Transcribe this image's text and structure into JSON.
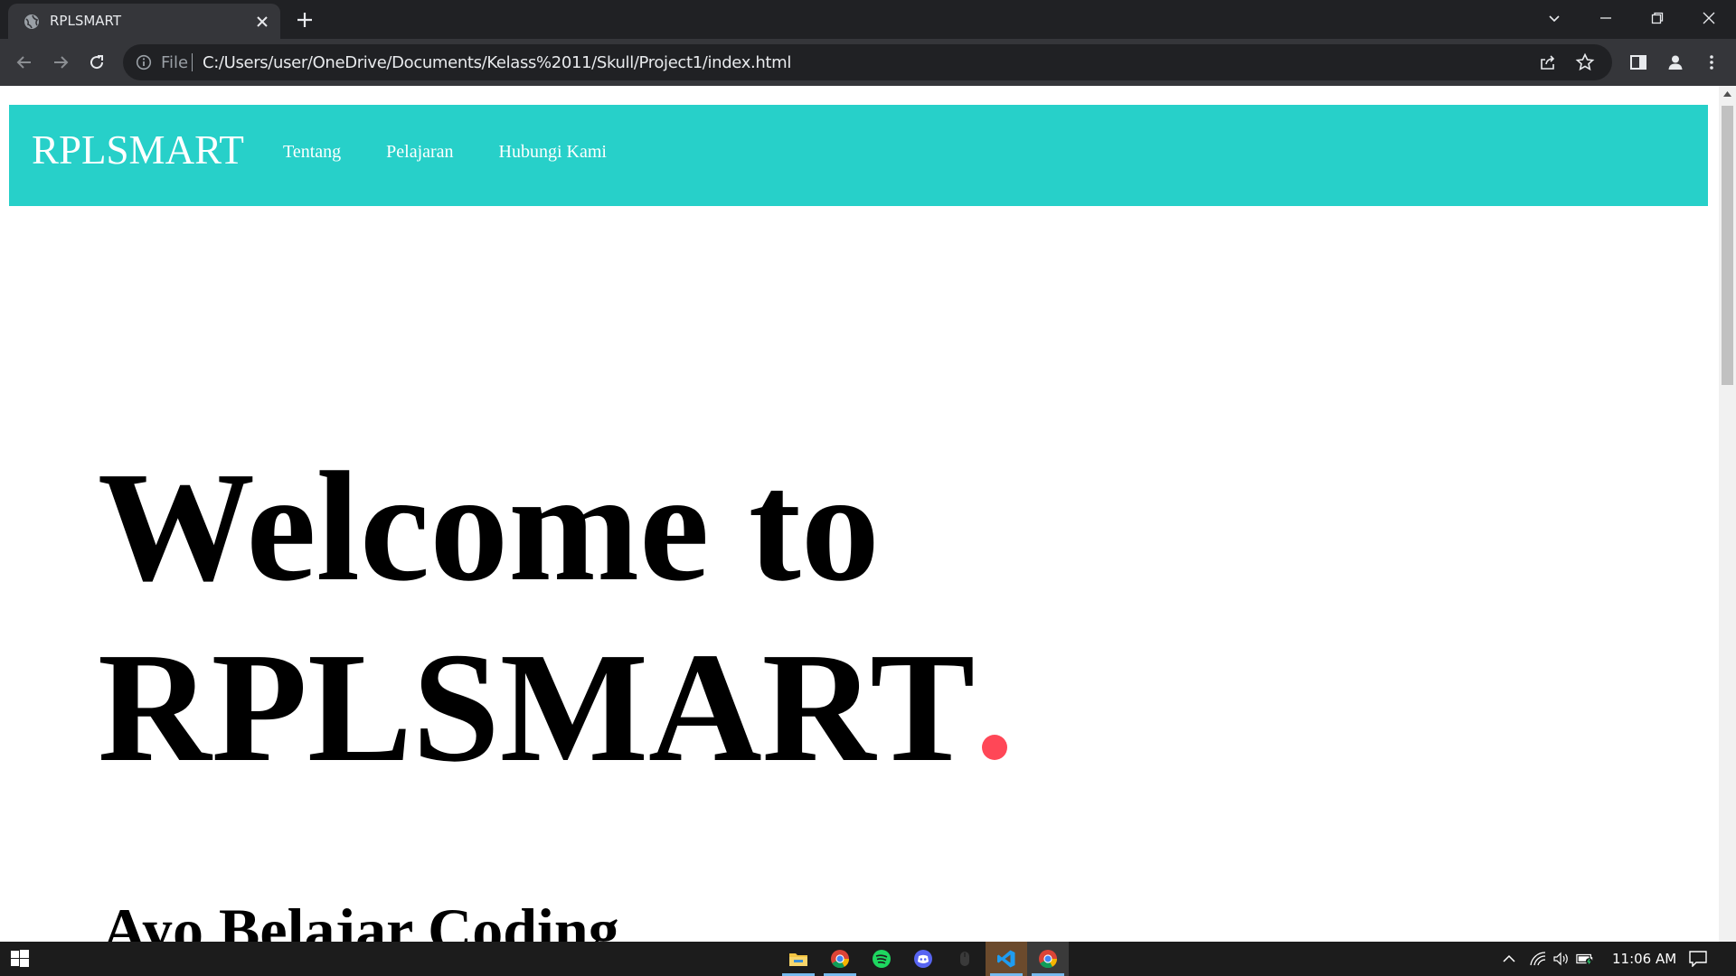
{
  "browser": {
    "tab_title": "RPLSMART",
    "omnibox_scheme_label": "File",
    "url": "C:/Users/user/OneDrive/Documents/Kelass%2011/Skull/Project1/index.html"
  },
  "site": {
    "brand": "RPLSMART",
    "nav": [
      "Tentang",
      "Pelajaran",
      "Hubungi Kami"
    ],
    "hero_line1": "Welcome to",
    "hero_line2": "RPLSMART",
    "subheading": "Ayo Belajar Coding",
    "colors": {
      "navbar": "#27d0c9",
      "accent_dot": "#ff4757"
    }
  },
  "taskbar": {
    "apps": [
      "file-explorer-icon",
      "chrome-icon",
      "spotify-icon",
      "discord-icon",
      "mouse-app-icon",
      "vscode-icon",
      "chrome-icon"
    ],
    "time": "11:06 AM"
  }
}
